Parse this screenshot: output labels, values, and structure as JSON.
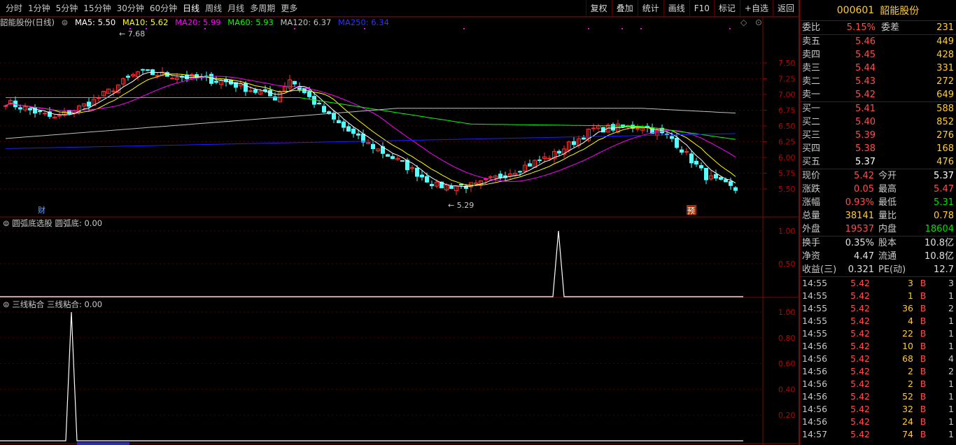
{
  "periods": [
    "分时",
    "1分钟",
    "5分钟",
    "15分钟",
    "30分钟",
    "60分钟",
    "日线",
    "周线",
    "月线",
    "多周期",
    "更多"
  ],
  "active_period": "日线",
  "tools": [
    "复权",
    "叠加",
    "统计",
    "画线",
    "F10",
    "标记",
    "+自选",
    "返回"
  ],
  "legend": {
    "name": "韶能股份(日线)",
    "ma5": "MA5: 5.50",
    "ma10": "MA10: 5.62",
    "ma20": "MA20: 5.99",
    "ma60": "MA60: 5.93",
    "ma120": "MA120: 6.37",
    "ma250": "MA250: 6.34"
  },
  "colors": {
    "ma5": "#ffffff",
    "ma10": "#ffff00",
    "ma20": "#ff00ff",
    "ma60": "#00ff00",
    "ma120": "#c0c0c0",
    "ma250": "#2020ff",
    "up": "#ff3030",
    "down": "#54ffff"
  },
  "price_axis": {
    "ticks": [
      "7.50",
      "7.25",
      "7.00",
      "6.75",
      "6.50",
      "6.25",
      "6.00",
      "5.75",
      "5.50"
    ]
  },
  "annotations": {
    "high": "7.68",
    "low": "5.29",
    "marker_cai": "财",
    "marker_yu": "预"
  },
  "sub1": {
    "label": "圆弧底选股 圆弧底: 0.00",
    "ticks": [
      "1.00",
      "0.50"
    ],
    "values": [
      0,
      0,
      0,
      1,
      0,
      0
    ]
  },
  "sub2": {
    "label": "三线粘合 三线粘合: 0.00",
    "ticks": [
      "1.00",
      "0.80",
      "0.60",
      "0.40",
      "0.20"
    ]
  },
  "stock": {
    "code": "000601",
    "name": "韶能股份"
  },
  "weibi": {
    "l1": "委比",
    "v1": "5.15%",
    "l2": "委差",
    "v2": "231"
  },
  "sells": [
    {
      "label": "卖五",
      "price": "5.46",
      "vol": "449"
    },
    {
      "label": "卖四",
      "price": "5.45",
      "vol": "428"
    },
    {
      "label": "卖三",
      "price": "5.44",
      "vol": "331"
    },
    {
      "label": "卖二",
      "price": "5.43",
      "vol": "272"
    },
    {
      "label": "卖一",
      "price": "5.42",
      "vol": "649"
    }
  ],
  "buys": [
    {
      "label": "买一",
      "price": "5.41",
      "vol": "588"
    },
    {
      "label": "买二",
      "price": "5.40",
      "vol": "852"
    },
    {
      "label": "买三",
      "price": "5.39",
      "vol": "276"
    },
    {
      "label": "买四",
      "price": "5.38",
      "vol": "168"
    },
    {
      "label": "买五",
      "price": "5.37",
      "vol": "476"
    }
  ],
  "stats": [
    {
      "a": "现价",
      "b": "5.42",
      "bc": "red",
      "c": "今开",
      "d": "5.37",
      "dc": "white"
    },
    {
      "a": "涨跌",
      "b": "0.05",
      "bc": "red",
      "c": "最高",
      "d": "5.47",
      "dc": "red"
    },
    {
      "a": "涨幅",
      "b": "0.93%",
      "bc": "red",
      "c": "最低",
      "d": "5.31",
      "dc": "green"
    },
    {
      "a": "总量",
      "b": "38141",
      "bc": "yellow",
      "c": "量比",
      "d": "0.78",
      "dc": "yellow"
    },
    {
      "a": "外盘",
      "b": "19537",
      "bc": "red",
      "c": "内盘",
      "d": "18604",
      "dc": "green"
    }
  ],
  "stats2": [
    {
      "a": "换手",
      "b": "0.35%",
      "c": "股本",
      "d": "10.8亿"
    },
    {
      "a": "净资",
      "b": "4.47",
      "c": "流通",
      "d": "10.8亿"
    },
    {
      "a": "收益(三)",
      "b": "0.321",
      "c": "PE(动)",
      "d": "12.7"
    }
  ],
  "ticks": [
    {
      "t": "14:55",
      "p": "5.42",
      "v": "3",
      "b": "B",
      "n": "3"
    },
    {
      "t": "14:55",
      "p": "5.42",
      "v": "1",
      "b": "B",
      "n": "1"
    },
    {
      "t": "14:55",
      "p": "5.42",
      "v": "36",
      "b": "B",
      "n": "2"
    },
    {
      "t": "14:55",
      "p": "5.42",
      "v": "4",
      "b": "B",
      "n": "1"
    },
    {
      "t": "14:55",
      "p": "5.42",
      "v": "22",
      "b": "B",
      "n": "1"
    },
    {
      "t": "14:56",
      "p": "5.42",
      "v": "10",
      "b": "B",
      "n": "1"
    },
    {
      "t": "14:56",
      "p": "5.42",
      "v": "68",
      "b": "B",
      "n": "4"
    },
    {
      "t": "14:56",
      "p": "5.42",
      "v": "2",
      "b": "B",
      "n": "2"
    },
    {
      "t": "14:56",
      "p": "5.42",
      "v": "2",
      "b": "B",
      "n": "1"
    },
    {
      "t": "14:56",
      "p": "5.42",
      "v": "52",
      "b": "B",
      "n": "1"
    },
    {
      "t": "14:56",
      "p": "5.42",
      "v": "32",
      "b": "B",
      "n": "1"
    },
    {
      "t": "14:56",
      "p": "5.42",
      "v": "24",
      "b": "B",
      "n": "1"
    },
    {
      "t": "14:57",
      "p": "5.42",
      "v": "74",
      "b": "B",
      "n": "1"
    }
  ]
}
